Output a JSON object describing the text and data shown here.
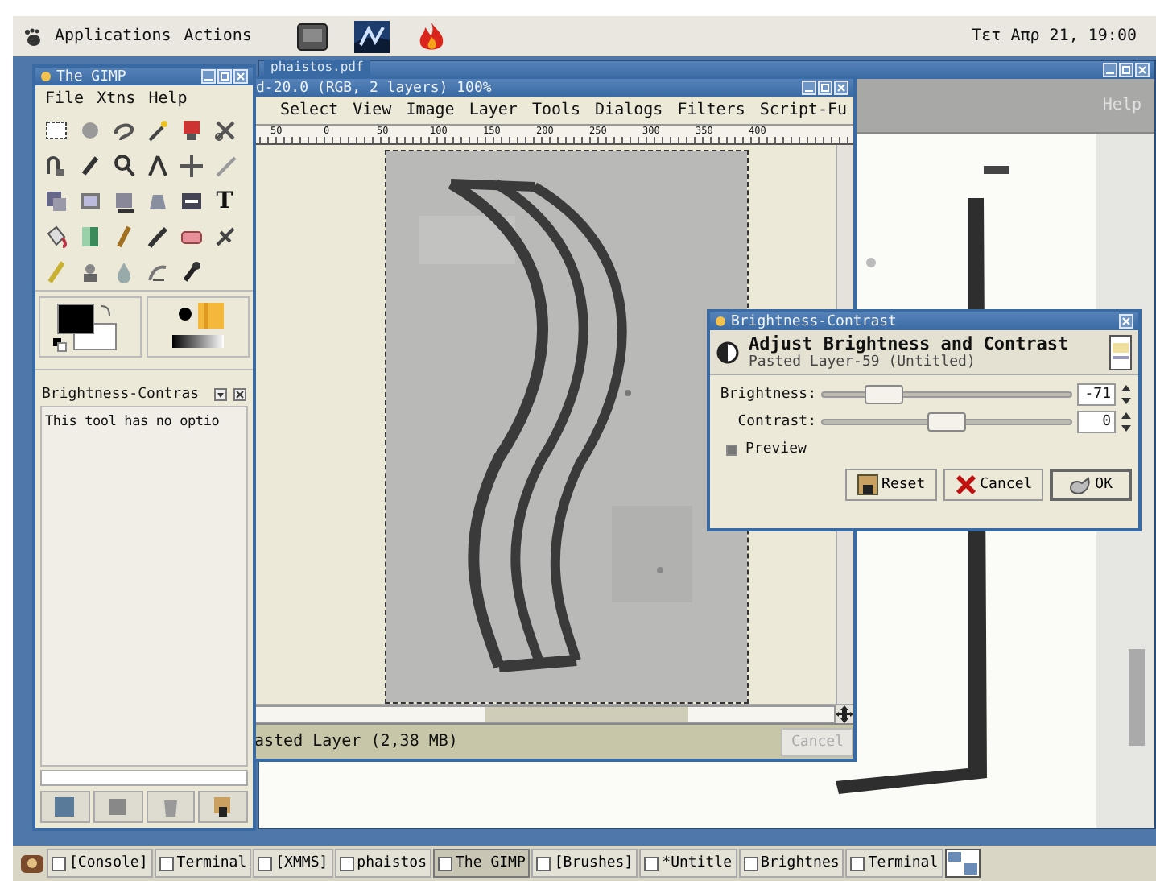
{
  "top_panel": {
    "menus": [
      "Applications",
      "Actions"
    ],
    "clock": "Τετ Απρ 21, 19:00"
  },
  "background_window": {
    "toolbar_button": "Help"
  },
  "toolbox": {
    "title": "The GIMP",
    "menus": [
      "File",
      "Xtns",
      "Help"
    ],
    "text_tool_glyph": "T",
    "dock_tab": "Brightness-Contras",
    "options_text": "This tool has no optio"
  },
  "image_window": {
    "behind_title": "phaistos.pdf",
    "title": "d-20.0 (RGB, 2 layers) 100%",
    "menus": [
      "Select",
      "View",
      "Image",
      "Layer",
      "Tools",
      "Dialogs",
      "Filters",
      "Script-Fu"
    ],
    "ruler_labels": [
      "50",
      "0",
      "50",
      "100",
      "150",
      "200",
      "250",
      "300",
      "350",
      "400"
    ],
    "status": "asted Layer (2,38 MB)",
    "cancel": {
      "label": "Cancel",
      "disabled": true
    }
  },
  "dialog": {
    "title": "Brightness-Contrast",
    "heading": "Adjust Brightness and Contrast",
    "subheading": "Pasted Layer-59 (Untitled)",
    "sliders": [
      {
        "label": "Brightness:",
        "level": 0.2,
        "value": "-71"
      },
      {
        "label": "Contrast:",
        "level": 0.5,
        "value": "0"
      }
    ],
    "preview": {
      "label": "Preview",
      "checked": true
    },
    "buttons": [
      {
        "label": "Reset",
        "kind": "reset"
      },
      {
        "label": "Cancel",
        "kind": "cancel"
      },
      {
        "label": "OK",
        "kind": "ok"
      }
    ]
  },
  "taskbar": {
    "items": [
      {
        "label": "[Console]",
        "selected": false
      },
      {
        "label": "Terminal",
        "selected": false
      },
      {
        "label": "[XMMS]",
        "selected": false
      },
      {
        "label": "phaistos",
        "selected": false
      },
      {
        "label": "The GIMP",
        "selected": true
      },
      {
        "label": "[Brushes]",
        "selected": false
      },
      {
        "label": "*Untitle",
        "selected": false
      },
      {
        "label": "Brightnes",
        "selected": false
      },
      {
        "label": "Terminal",
        "selected": false
      }
    ]
  }
}
